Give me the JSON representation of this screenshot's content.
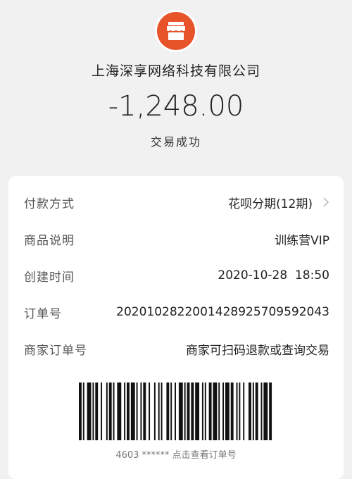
{
  "header": {
    "merchant_icon": "store-icon",
    "merchant_name": "上海深享网络科技有限公司",
    "amount": "-1,248.00",
    "status": "交易成功",
    "accent_color": "#e8542a"
  },
  "details": {
    "payment_method_label": "付款方式",
    "payment_method_value": "花呗分期(12期)",
    "product_desc_label": "商品说明",
    "product_desc_value": "训练营VIP",
    "created_time_label": "创建时间",
    "created_time_value": "2020-10-28  18:50",
    "order_no_label": "订单号",
    "order_no_value": "2020102822001428925709592043",
    "merchant_order_label": "商家订单号",
    "merchant_order_value": "商家可扫码退款或查询交易"
  },
  "barcode": {
    "caption": "4603 ****** 点击查看订单号"
  }
}
